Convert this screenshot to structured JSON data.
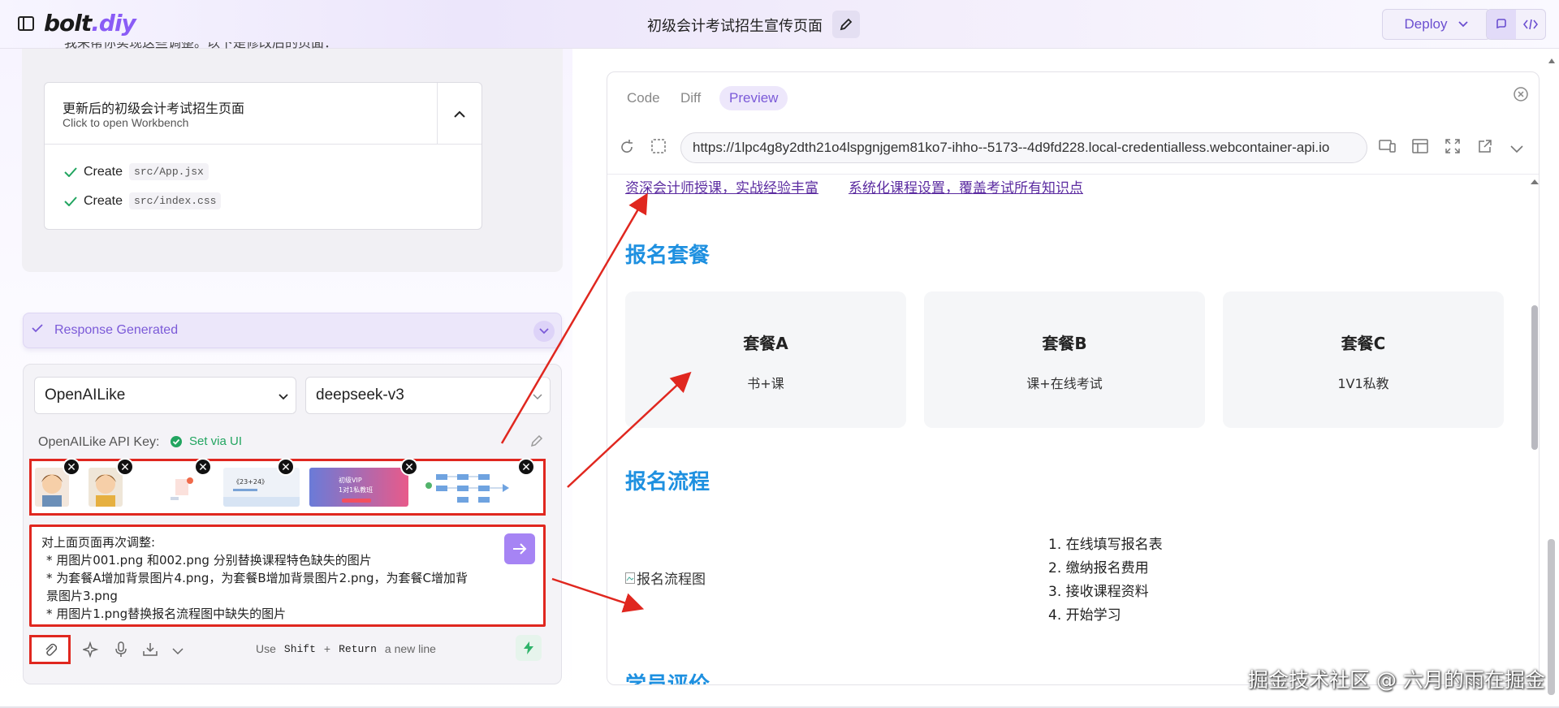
{
  "header": {
    "logo_text": "bolt",
    "logo_suffix": ".diy",
    "project_title": "初级会计考试招生宣传页面",
    "deploy_label": "Deploy"
  },
  "chat": {
    "cut_text": "我来帮你实现这些调整。以下是修改后的页面：",
    "artifact": {
      "title": "更新后的初级会计考试招生页面",
      "subtitle": "Click to open Workbench",
      "actions": [
        {
          "verb": "Create",
          "file": "src/App.jsx"
        },
        {
          "verb": "Create",
          "file": "src/index.css"
        }
      ]
    },
    "response_label": "Response Generated"
  },
  "input": {
    "provider": "OpenAILike",
    "model": "deepseek-v3",
    "api_label": "OpenAILike API Key:",
    "api_status": "Set via UI",
    "prompt_lines": [
      "对上面页面再次调整:",
      "* 用图片001.png 和002.png 分别替换课程特色缺失的图片",
      "* 为套餐A增加背景图片4.png，为套餐B增加背景图片2.png，为套餐C增加背",
      "景图片3.png",
      "* 用图片1.png替换报名流程图中缺失的图片"
    ],
    "hint_use": "Use",
    "hint_shift": "Shift",
    "hint_plus": "+",
    "hint_return": "Return",
    "hint_newline": "a new line",
    "thumb_texts": {
      "poster1": "《23+24》",
      "poster2_line1": "初级VIP",
      "poster2_line2": "1对1私教班"
    }
  },
  "workbench": {
    "tabs": [
      "Code",
      "Diff",
      "Preview"
    ],
    "active_tab": "Preview",
    "url": "https://1lpc4g8y2dth21o4lspgnjgem81ko7-ihho--5173--4d9fd228.local-credentialless.webcontainer-api.io"
  },
  "preview": {
    "links": [
      "资深会计师授课，实战经验丰富",
      "系统化课程设置，覆盖考试所有知识点"
    ],
    "packages_title": "报名套餐",
    "packages": [
      {
        "name": "套餐A",
        "desc": "书+课"
      },
      {
        "name": "套餐B",
        "desc": "课+在线考试"
      },
      {
        "name": "套餐C",
        "desc": "1V1私教"
      }
    ],
    "process_title": "报名流程",
    "process_img_alt": "报名流程图",
    "steps": [
      "1. 在线填写报名表",
      "2. 缴纳报名费用",
      "3. 接收课程资料",
      "4. 开始学习"
    ],
    "next_section_cut": "学员评价"
  },
  "watermark": "掘金技术社区 @ 六月的雨在掘金",
  "colors": {
    "accent": "#7b5ad8",
    "annotation_red": "#e0271f",
    "section_blue": "#1e90e0",
    "link_purple": "#5b2ba0"
  }
}
